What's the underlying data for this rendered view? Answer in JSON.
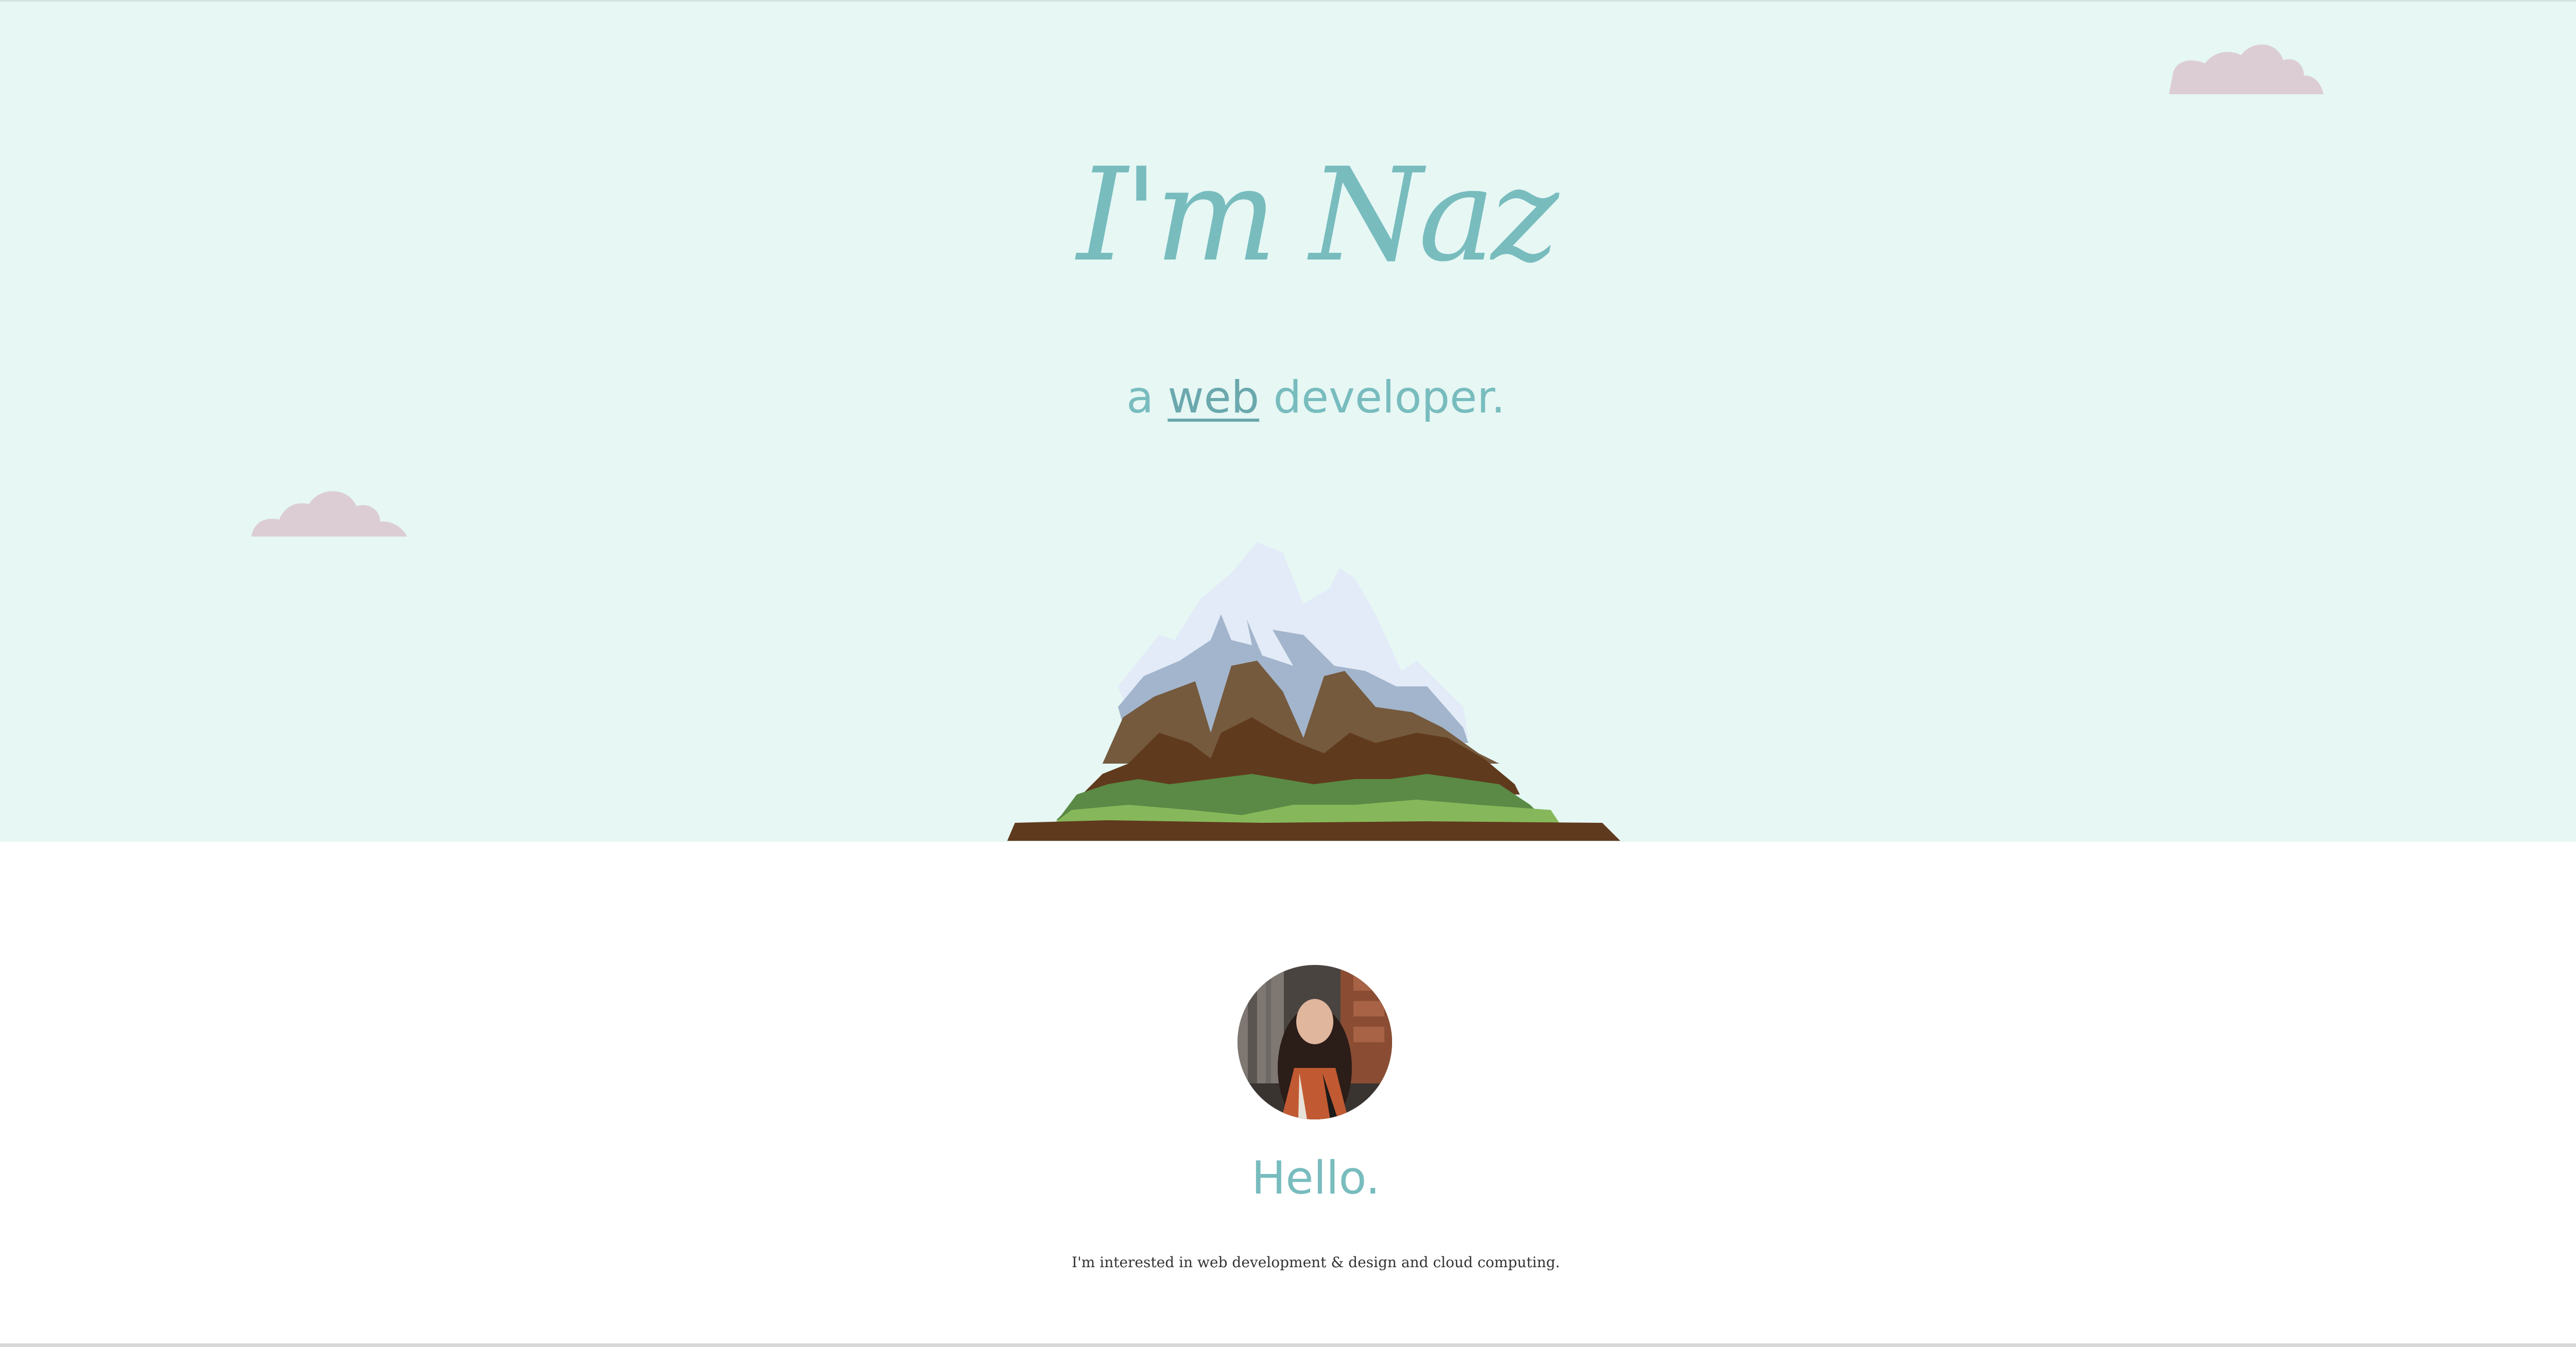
{
  "hero": {
    "title": "I'm Naz",
    "tagline_prefix": "a ",
    "tagline_link": "web",
    "tagline_suffix": " developer."
  },
  "about": {
    "greeting": "Hello.",
    "intro": "I'm interested in web development & design and cloud computing."
  },
  "colors": {
    "sky": "#e6f7f4",
    "accent": "#78bcbe",
    "cloud": "#dccdd5",
    "text": "#333333"
  },
  "icons": {
    "clouds": "cloud-icon",
    "illustration": "mountain-illustration"
  }
}
